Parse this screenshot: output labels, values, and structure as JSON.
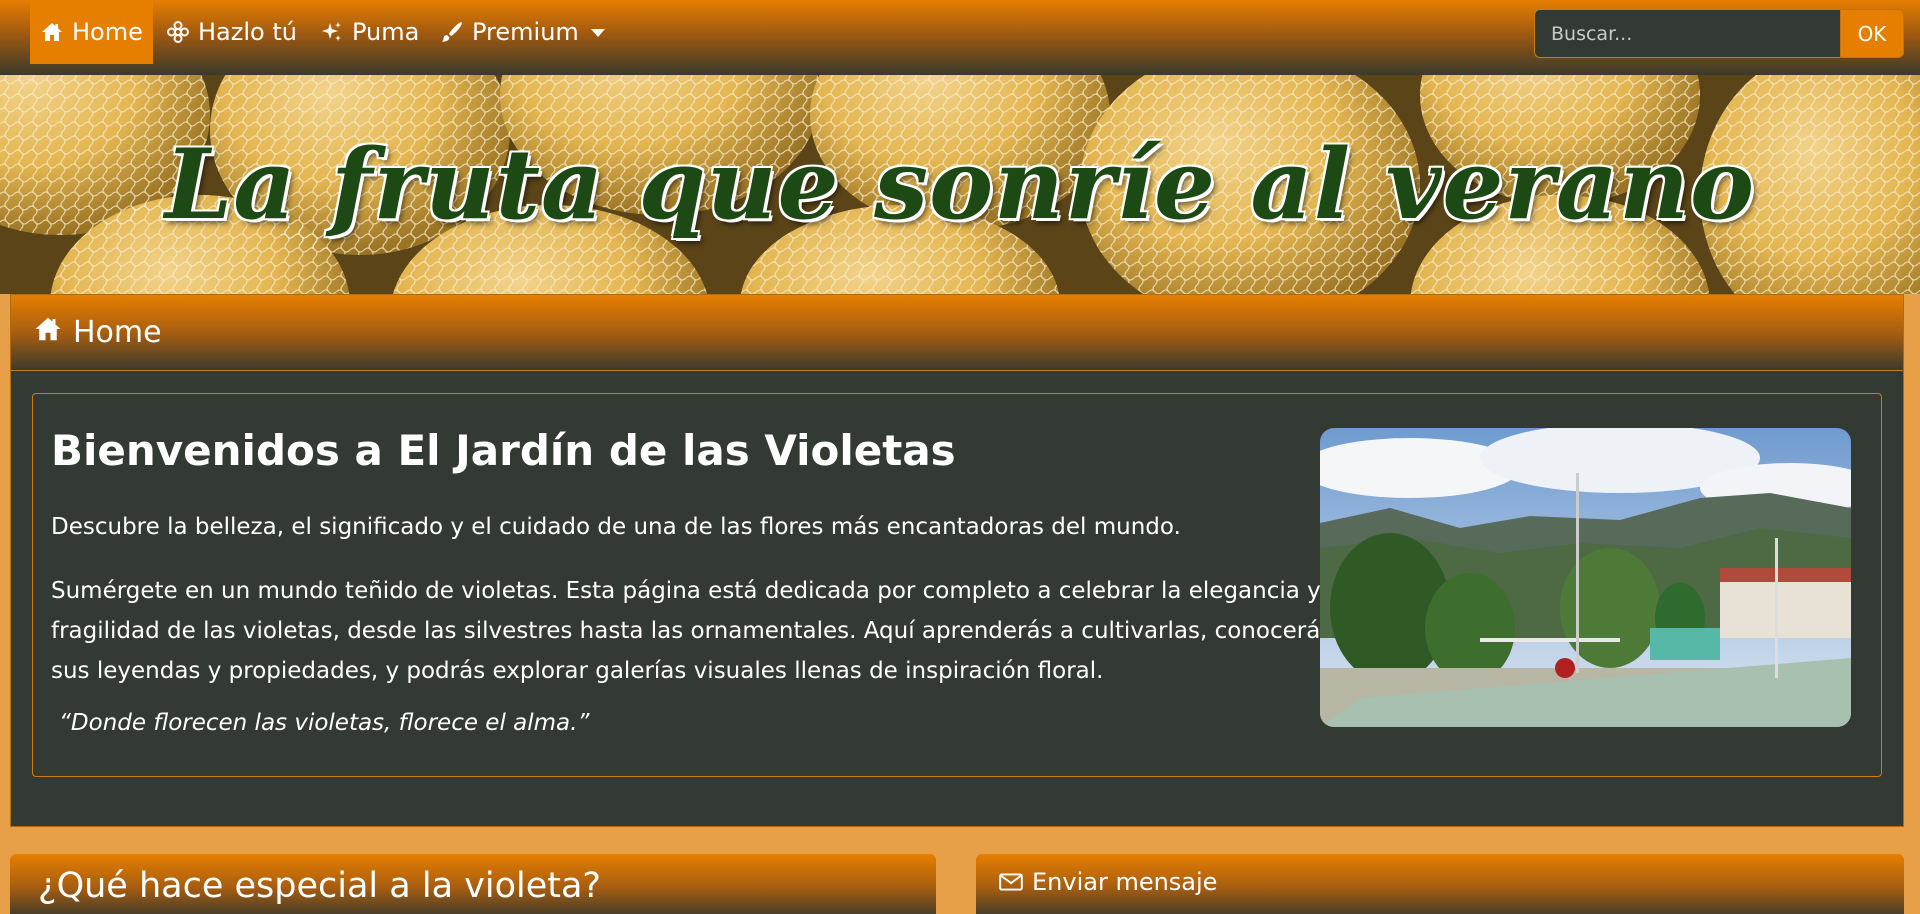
{
  "navbar": {
    "items": [
      {
        "label": "Home",
        "icon": "house-icon",
        "active": true
      },
      {
        "label": "Hazlo tú",
        "icon": "flower-icon",
        "active": false
      },
      {
        "label": "Puma",
        "icon": "sparkles-icon",
        "active": false
      },
      {
        "label": "Premium",
        "icon": "brush-icon",
        "active": false,
        "dropdown": true
      }
    ],
    "search": {
      "placeholder": "Buscar...",
      "value": "",
      "button_label": "OK"
    }
  },
  "banner": {
    "title": "La fruta que sonríe al verano"
  },
  "home_card": {
    "header": "Home",
    "welcome_title": "Bienvenidos a El Jardín de las Violetas",
    "intro": "Descubre la belleza, el significado y el cuidado de una de las flores más encantadoras del mundo.",
    "body": "Sumérgete en un mundo teñido de violetas. Esta página está dedicada por completo a celebrar la elegancia y fragilidad de las violetas, desde las silvestres hasta las ornamentales. Aquí aprenderás a cultivarlas, conocerás sus leyendas y propiedades, y podrás explorar galerías visuales llenas de inspiración floral.",
    "quote": "“Donde florecen las violetas, florece el alma.”"
  },
  "cards": {
    "left_title": "¿Qué hace especial a la violeta?",
    "right_title": "Enviar mensaje"
  },
  "colors": {
    "accent": "#e67e00",
    "panel": "#333a34",
    "page_bg": "#e8a048",
    "title_green": "#1d4a14"
  }
}
